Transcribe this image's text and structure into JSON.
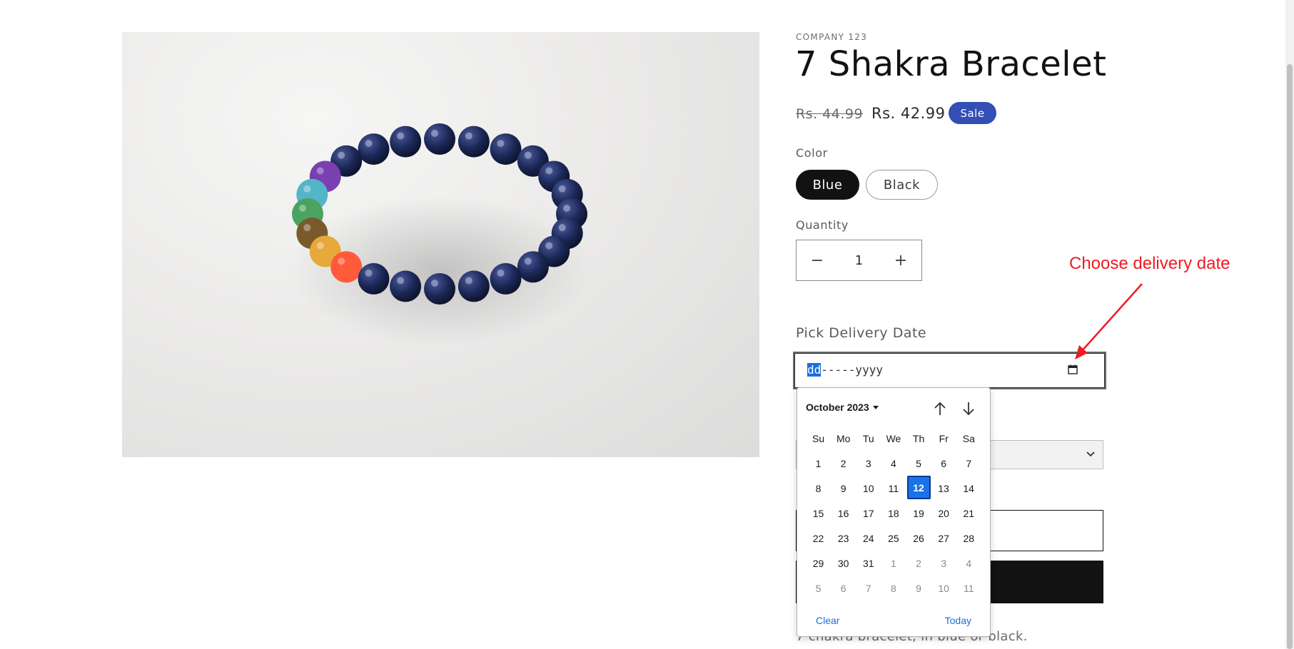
{
  "product": {
    "vendor": "COMPANY 123",
    "title": "7 Shakra Bracelet",
    "price_regular": "Rs. 44.99",
    "price_sale": "Rs. 42.99",
    "badge": "Sale",
    "description": "7 chakra bracelet, in blue or black."
  },
  "options": {
    "color_label": "Color",
    "colors": [
      "Blue",
      "Black"
    ],
    "selected_color": "Blue"
  },
  "quantity": {
    "label": "Quantity",
    "value": "1",
    "minus": "−",
    "plus": "+"
  },
  "delivery": {
    "label": "Pick Delivery Date",
    "placeholder_day": "dd",
    "placeholder_rest": "-----yyyy"
  },
  "datepicker": {
    "month_label": "October 2023",
    "weekdays": [
      "Su",
      "Mo",
      "Tu",
      "We",
      "Th",
      "Fr",
      "Sa"
    ],
    "weeks": [
      [
        "1",
        "2",
        "3",
        "4",
        "5",
        "6",
        "7"
      ],
      [
        "8",
        "9",
        "10",
        "11",
        "12",
        "13",
        "14"
      ],
      [
        "15",
        "16",
        "17",
        "18",
        "19",
        "20",
        "21"
      ],
      [
        "22",
        "23",
        "24",
        "25",
        "26",
        "27",
        "28"
      ],
      [
        "29",
        "30",
        "31",
        "1",
        "2",
        "3",
        "4"
      ],
      [
        "5",
        "6",
        "7",
        "8",
        "9",
        "10",
        "11"
      ]
    ],
    "selected_day": "12",
    "clear_label": "Clear",
    "today_label": "Today"
  },
  "annotation": {
    "text": "Choose delivery date",
    "color": "#ee1c24"
  },
  "colors": {
    "sale_badge": "#334fb4",
    "selected_day": "#1a73e8",
    "link": "#1a6fd1"
  }
}
